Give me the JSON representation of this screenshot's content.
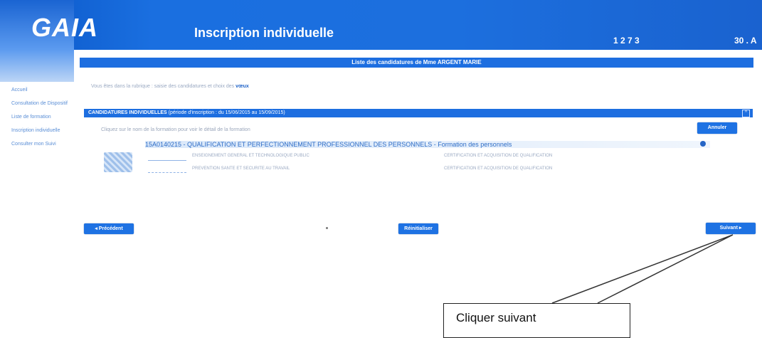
{
  "header": {
    "logo": "GAIA",
    "title": "Inscription individuelle",
    "code": "1 2 7 3",
    "right_text": "30 . A"
  },
  "title_bar": "Liste des candidatures de Mme ARGENT MARIE",
  "sidebar": {
    "items": [
      {
        "label": "Accueil"
      },
      {
        "label": "Consultation de Dispositif"
      },
      {
        "label": "Liste de formation"
      },
      {
        "label": "Inscription individuelle"
      },
      {
        "label": "Consulter mon Suivi"
      }
    ]
  },
  "breadcrumb": {
    "text": "Vous êtes dans la rubrique : saisie des candidatures et choix des",
    "bold": "vœux"
  },
  "candidatures_bar": {
    "label": "CANDIDATURES INDIVIDUELLES",
    "detail": "(période d'inscription : du 15/06/2015 au 15/09/2015)",
    "icon": "collapse-icon"
  },
  "hint": "Cliquez sur le nom de la formation pour voir le détail de la formation",
  "buttons": {
    "cancel": "Annuler",
    "previous": "◂  Précédent",
    "reset": "Réinitialiser",
    "next": "Suivant   ▸"
  },
  "formation": {
    "title": "15A0140215 - QUALIFICATION ET PERFECTIONNEMENT PROFESSIONNEL DES PERSONNELS - Formation des personnels",
    "lines": [
      {
        "left": "ENSEIGNEMENT GENERAL ET TECHNOLOGIQUE PUBLIC",
        "right": "CERTIFICATION ET ACQUISITION DE QUALIFICATION"
      },
      {
        "left": "PREVENTION SANTE ET SECURITE AU TRAVAIL",
        "right": "CERTIFICATION ET ACQUISITION DE QUALIFICATION"
      }
    ]
  },
  "callout": {
    "text": "Cliquer suivant"
  },
  "colors": {
    "brand_blue": "#1d6ee0",
    "header_blue": "#0a56c6"
  }
}
